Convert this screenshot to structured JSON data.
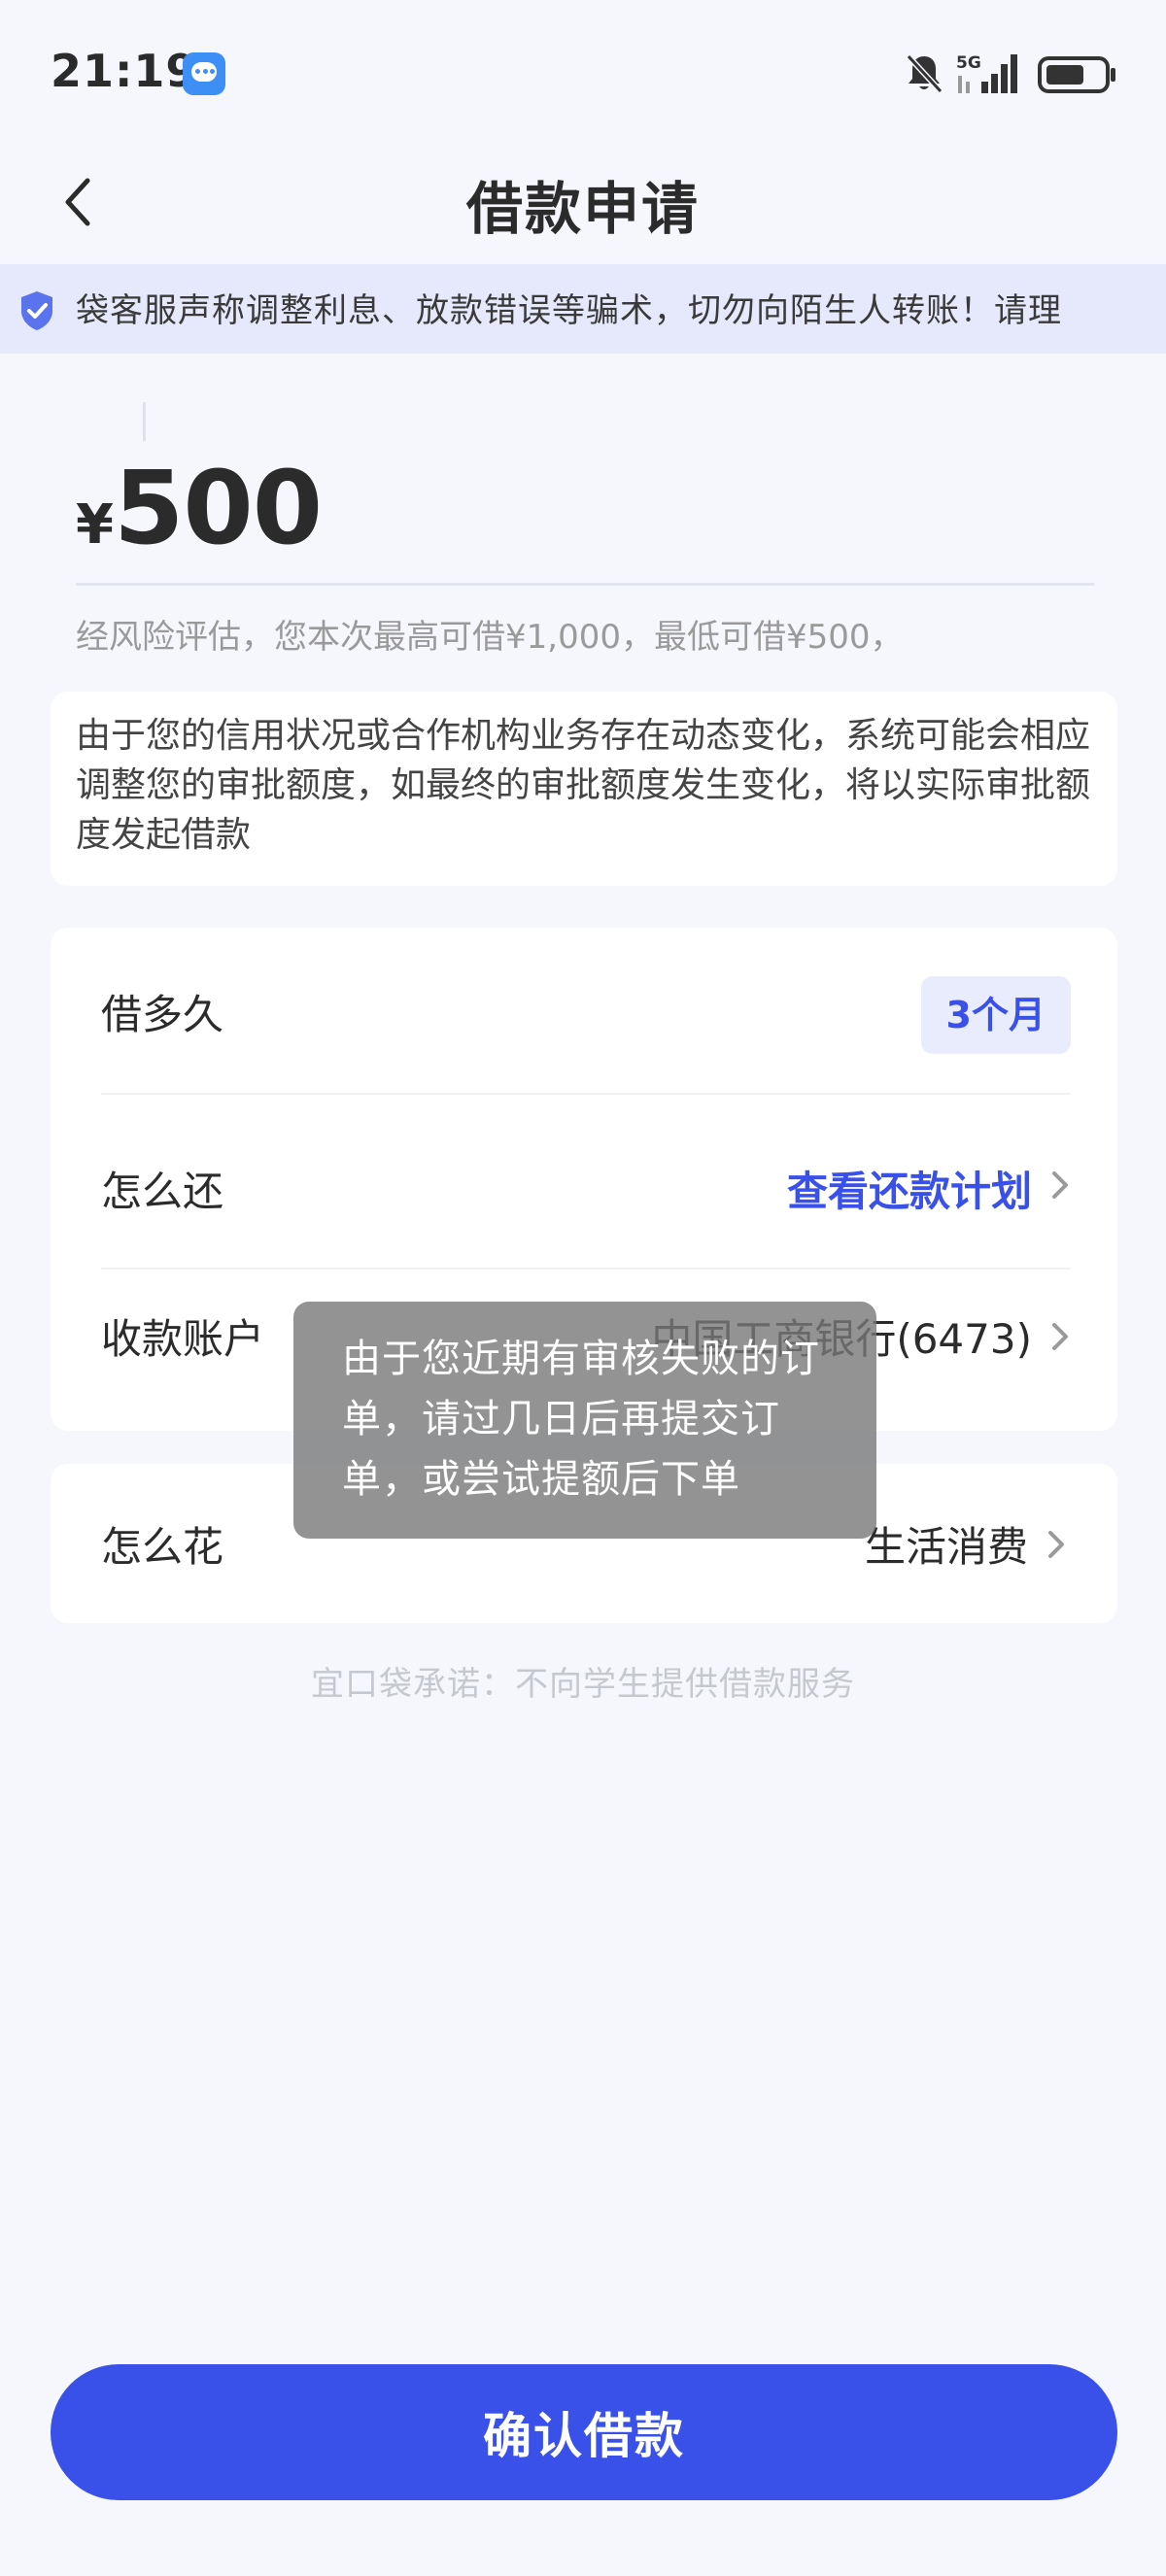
{
  "status_bar": {
    "time": "21:19",
    "network": "5G",
    "icons": [
      "message-icon",
      "bell-off-icon",
      "signal-icon",
      "battery-icon"
    ]
  },
  "header": {
    "title": "借款申请",
    "back_icon": "chevron-left-icon"
  },
  "notice": {
    "icon": "shield-check-icon",
    "text": "袋客服声称调整利息、放款错误等骗术，切勿向陌生人转账！请理"
  },
  "amount": {
    "currency": "¥",
    "value": "500",
    "limit_text": "经风险评估，您本次最高可借¥1,000，最低可借¥500，"
  },
  "info_card": {
    "text": "由于您的信用状况或合作机构业务存在动态变化，系统可能会相应调整您的审批额度，如最终的审批额度发生变化，将以实际审批额度发起借款"
  },
  "details": {
    "term": {
      "label": "借多久",
      "value": "3个月"
    },
    "repay": {
      "label": "怎么还",
      "value": "查看还款计划"
    },
    "account": {
      "label": "收款账户",
      "value": "中国工商银行(6473)"
    },
    "spend": {
      "label": "怎么花",
      "value": "生活消费"
    }
  },
  "promise": "宜口袋承诺：不向学生提供借款服务",
  "toast": {
    "text": "由于您近期有审核失败的订单，请过几日后再提交订单，或尝试提额后下单"
  },
  "confirm_button": "确认借款",
  "colors": {
    "accent": "#3951e8",
    "background": "#f6f7fd",
    "notice_bg": "#e6e9fb"
  }
}
